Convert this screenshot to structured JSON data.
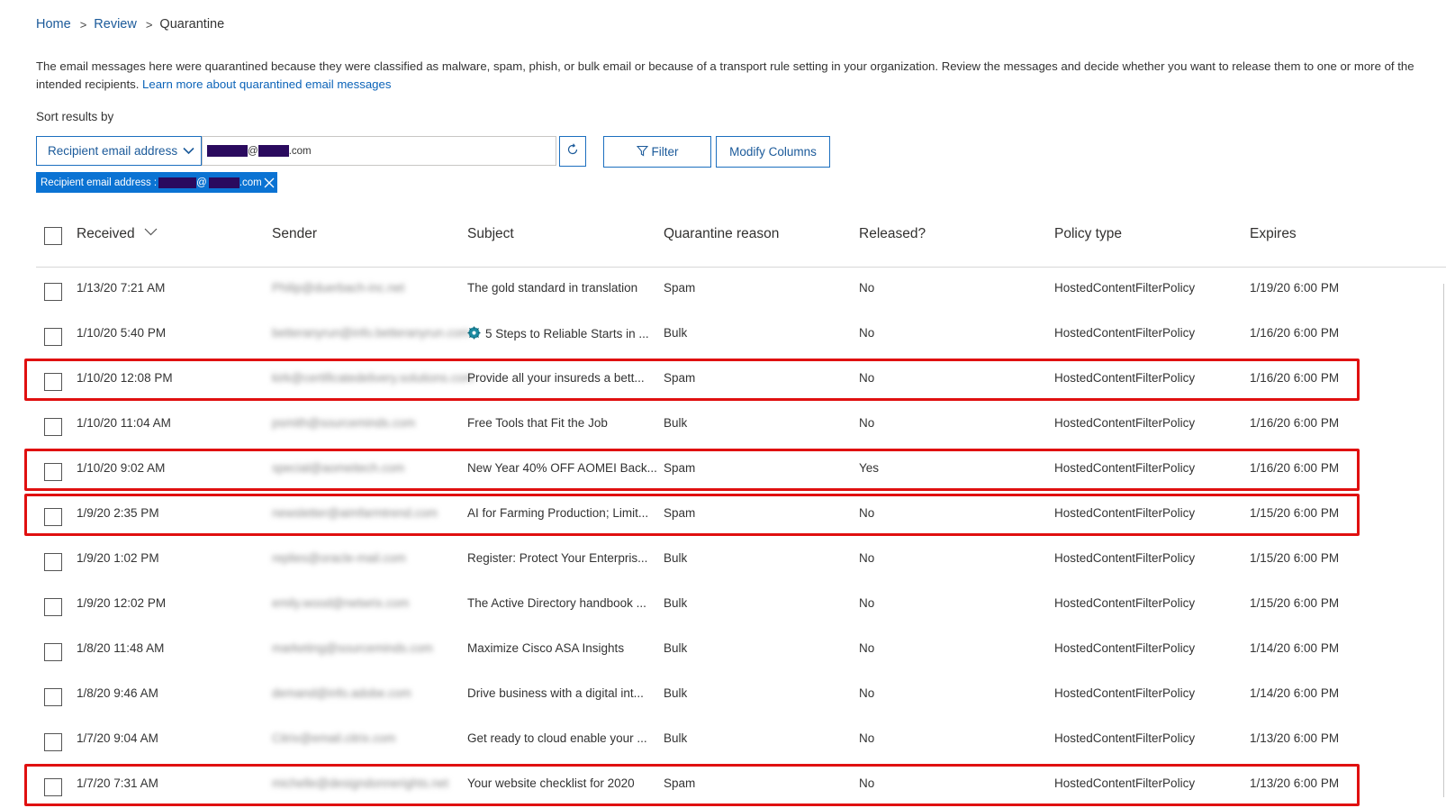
{
  "breadcrumb": {
    "home": "Home",
    "review": "Review",
    "current": "Quarantine",
    "sep": ">"
  },
  "description": {
    "text": "The email messages here were quarantined because they were classified as malware, spam, phish, or bulk email or because of a transport rule setting in your organization. Review the messages and decide whether you want to release them to one or more of the intended recipients.",
    "link": "Learn more about quarantined email messages"
  },
  "sort": {
    "label": "Sort results by",
    "selected": "Recipient email address",
    "search_at": "@",
    "search_suffix": ".com"
  },
  "buttons": {
    "filter": "Filter",
    "modify_columns": "Modify Columns"
  },
  "chip": {
    "label": "Recipient email address :",
    "at": "@",
    "suffix": ".com"
  },
  "table": {
    "columns": [
      "Received",
      "Sender",
      "Subject",
      "Quarantine reason",
      "Released?",
      "Policy type",
      "Expires"
    ],
    "rows": [
      {
        "received": "1/13/20 7:21 AM",
        "sender": "Philip@duerbach-inc.net",
        "subject": "The gold standard in translation",
        "reason": "Spam",
        "released": "No",
        "policy": "HostedContentFilterPolicy",
        "expires": "1/19/20 6:00 PM",
        "highlighted": false
      },
      {
        "received": "1/10/20 5:40 PM",
        "sender": "betteranyrun@info.betteranyrun.com",
        "subject": "5 Steps to Reliable Starts in ...",
        "reason": "Bulk",
        "released": "No",
        "policy": "HostedContentFilterPolicy",
        "expires": "1/16/20 6:00 PM",
        "highlighted": false,
        "icon": "gear-icon"
      },
      {
        "received": "1/10/20 12:08 PM",
        "sender": "kirk@certificatedelivery.solutions.com",
        "subject": "Provide all your insureds a bett...",
        "reason": "Spam",
        "released": "No",
        "policy": "HostedContentFilterPolicy",
        "expires": "1/16/20 6:00 PM",
        "highlighted": true
      },
      {
        "received": "1/10/20 11:04 AM",
        "sender": "psmith@sourceminds.com",
        "subject": "Free Tools that Fit the Job",
        "reason": "Bulk",
        "released": "No",
        "policy": "HostedContentFilterPolicy",
        "expires": "1/16/20 6:00 PM",
        "highlighted": false
      },
      {
        "received": "1/10/20 9:02 AM",
        "sender": "special@aomeitech.com",
        "subject": "New Year 40% OFF AOMEI Back...",
        "reason": "Spam",
        "released": "Yes",
        "policy": "HostedContentFilterPolicy",
        "expires": "1/16/20 6:00 PM",
        "highlighted": true
      },
      {
        "received": "1/9/20 2:35 PM",
        "sender": "newsletter@aimfarmtrend.com",
        "subject": "AI for Farming Production; Limit...",
        "reason": "Spam",
        "released": "No",
        "policy": "HostedContentFilterPolicy",
        "expires": "1/15/20 6:00 PM",
        "highlighted": true
      },
      {
        "received": "1/9/20 1:02 PM",
        "sender": "replies@oracle-mail.com",
        "subject": "Register: Protect Your Enterpris...",
        "reason": "Bulk",
        "released": "No",
        "policy": "HostedContentFilterPolicy",
        "expires": "1/15/20 6:00 PM",
        "highlighted": false
      },
      {
        "received": "1/9/20 12:02 PM",
        "sender": "emily.wood@netwrix.com",
        "subject": "The Active Directory handbook ...",
        "reason": "Bulk",
        "released": "No",
        "policy": "HostedContentFilterPolicy",
        "expires": "1/15/20 6:00 PM",
        "highlighted": false
      },
      {
        "received": "1/8/20 11:48 AM",
        "sender": "marketing@sourceminds.com",
        "subject": "Maximize Cisco ASA Insights",
        "reason": "Bulk",
        "released": "No",
        "policy": "HostedContentFilterPolicy",
        "expires": "1/14/20 6:00 PM",
        "highlighted": false
      },
      {
        "received": "1/8/20 9:46 AM",
        "sender": "demand@info.adobe.com",
        "subject": "Drive business with a digital int...",
        "reason": "Bulk",
        "released": "No",
        "policy": "HostedContentFilterPolicy",
        "expires": "1/14/20 6:00 PM",
        "highlighted": false
      },
      {
        "received": "1/7/20 9:04 AM",
        "sender": "Citrix@email.citrix.com",
        "subject": "Get ready to cloud enable your ...",
        "reason": "Bulk",
        "released": "No",
        "policy": "HostedContentFilterPolicy",
        "expires": "1/13/20 6:00 PM",
        "highlighted": false
      },
      {
        "received": "1/7/20 7:31 AM",
        "sender": "michelle@designdonnerights.net",
        "subject": "Your website checklist for 2020",
        "reason": "Spam",
        "released": "No",
        "policy": "HostedContentFilterPolicy",
        "expires": "1/13/20 6:00 PM",
        "highlighted": true
      }
    ]
  },
  "colors": {
    "link": "#1b5a9a",
    "accent": "#0b73d3",
    "highlight_border": "#e01010",
    "redaction": "#2a0a5e"
  }
}
